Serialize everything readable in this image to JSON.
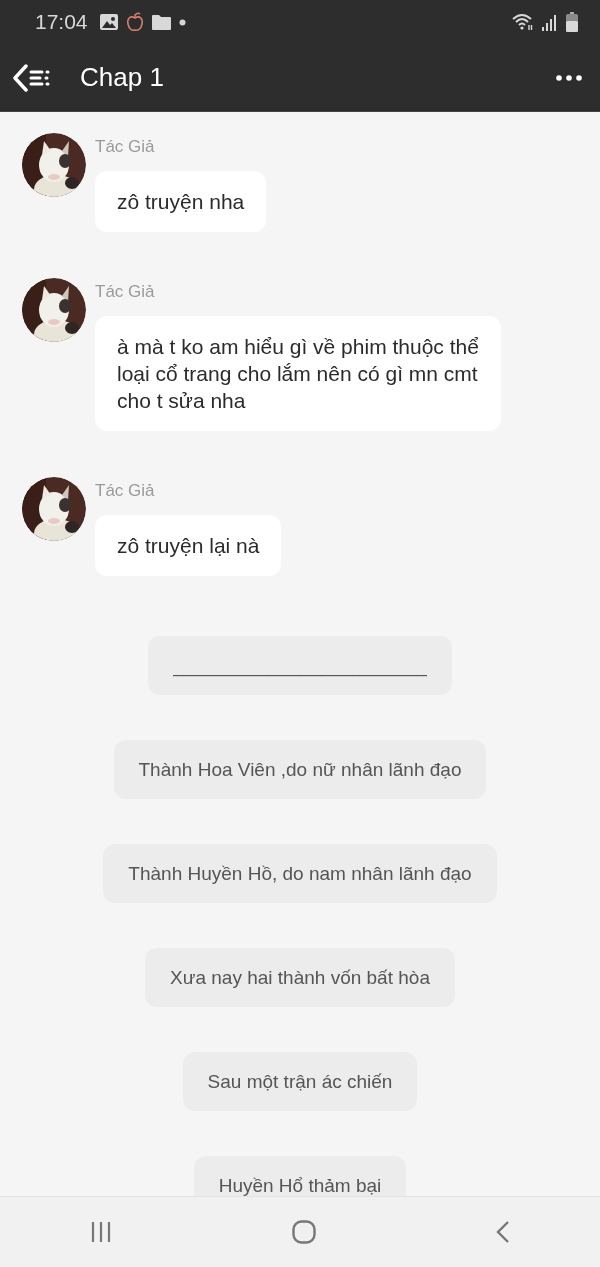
{
  "status_bar": {
    "time": "17:04"
  },
  "app_bar": {
    "title": "Chap 1"
  },
  "messages": [
    {
      "author": "Tác Giả",
      "text": "zô truyện nha"
    },
    {
      "author": "Tác Giả",
      "text": "à mà t ko am hiểu gì về phim thuộc thể loại cổ trang cho lắm nên có gì mn cmt cho t sửa nha"
    },
    {
      "author": "Tác Giả",
      "text": "zô truyện lại nà"
    }
  ],
  "narration": [
    {
      "text": "________________________"
    },
    {
      "text": "Thành Hoa Viên ,do nữ nhân lãnh đạo"
    },
    {
      "text": "Thành Huyền Hồ, do nam nhân lãnh đạo"
    },
    {
      "text": "Xưa nay hai thành vốn bất hòa"
    },
    {
      "text": "Sau một trận ác chiến"
    },
    {
      "text": "Huyền Hổ thảm bại"
    }
  ]
}
